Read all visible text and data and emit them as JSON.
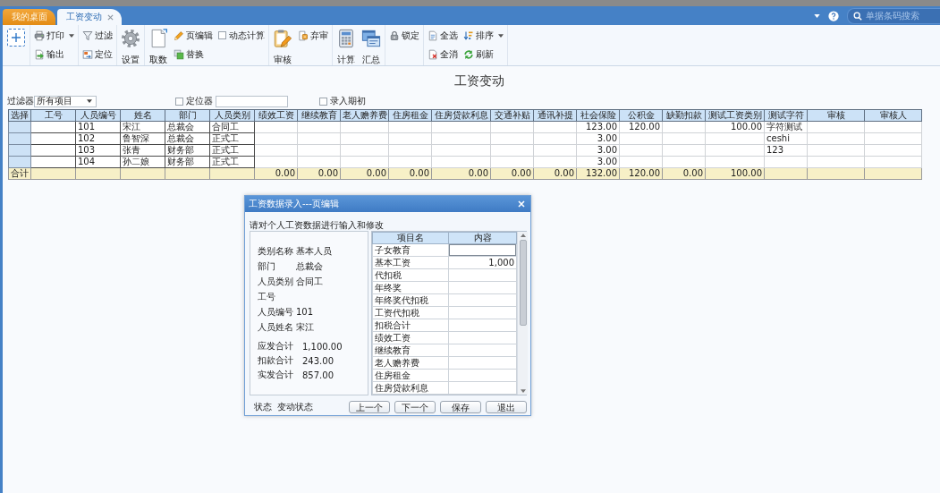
{
  "tabs": [
    {
      "label": "我的桌面",
      "selected": false,
      "closable": false
    },
    {
      "label": "工资变动",
      "selected": true,
      "closable": true
    }
  ],
  "search": {
    "placeholder": "单据条码搜索"
  },
  "toolbar": [
    {
      "items": [
        {
          "kind": "small",
          "label": "打印",
          "dropdown": true
        },
        {
          "kind": "small",
          "label": "输出",
          "dropdown": false
        }
      ]
    },
    {
      "items": [
        {
          "kind": "small",
          "label": "过滤",
          "dropdown": false
        },
        {
          "kind": "small",
          "label": "定位",
          "dropdown": false
        }
      ]
    },
    {
      "items": [
        {
          "kind": "large",
          "label": "设置"
        }
      ]
    },
    {
      "items": [
        {
          "kind": "large",
          "label": "取数"
        },
        {
          "kind": "small",
          "label": "页编辑",
          "dropdown": false
        },
        {
          "kind": "small",
          "label": "替换",
          "dropdown": false
        },
        {
          "kind": "check",
          "label": "动态计算",
          "checked": false
        }
      ]
    },
    {
      "items": [
        {
          "kind": "large",
          "label": "审核"
        },
        {
          "kind": "small",
          "label": "弃审",
          "dropdown": false
        }
      ]
    },
    {
      "items": [
        {
          "kind": "large",
          "label": "计算"
        },
        {
          "kind": "large",
          "label": "汇总"
        }
      ]
    },
    {
      "items": [
        {
          "kind": "small",
          "label": "锁定",
          "dropdown": false
        }
      ]
    },
    {
      "items": [
        {
          "kind": "small",
          "label": "全选",
          "dropdown": false
        },
        {
          "kind": "small",
          "label": "全消",
          "dropdown": false
        },
        {
          "kind": "small",
          "label": "排序",
          "dropdown": true
        },
        {
          "kind": "small",
          "label": "刷新",
          "dropdown": false
        }
      ]
    }
  ],
  "page_title": "工资变动",
  "filter": {
    "label": "过滤器",
    "value": "所有项目"
  },
  "locator": {
    "label": "定位器",
    "checked": false
  },
  "opening_entry": {
    "label": "录入期初",
    "checked": false
  },
  "table": {
    "columns": [
      {
        "label": "选择",
        "kind": "select"
      },
      {
        "label": "工号",
        "kind": "key"
      },
      {
        "label": "人员编号",
        "kind": "key"
      },
      {
        "label": "姓名",
        "kind": "key"
      },
      {
        "label": "部门",
        "kind": "key"
      },
      {
        "label": "人员类别",
        "kind": "key"
      },
      {
        "label": "绩效工资",
        "kind": "number"
      },
      {
        "label": "继续教育",
        "kind": "number"
      },
      {
        "label": "老人赡养费",
        "kind": "number"
      },
      {
        "label": "住房租金",
        "kind": "number"
      },
      {
        "label": "住房贷款利息",
        "kind": "number"
      },
      {
        "label": "交通补贴",
        "kind": "number"
      },
      {
        "label": "通讯补提",
        "kind": "number"
      },
      {
        "label": "社会保险",
        "kind": "number"
      },
      {
        "label": "公积金",
        "kind": "number"
      },
      {
        "label": "缺勤扣款",
        "kind": "number"
      },
      {
        "label": "测试工资类别",
        "kind": "number"
      },
      {
        "label": "测试字符",
        "kind": "text"
      },
      {
        "label": "审核",
        "kind": "text"
      },
      {
        "label": "审核人",
        "kind": "text"
      }
    ],
    "rows": [
      {
        "selected": false,
        "cells": [
          "",
          "",
          "101",
          "宋江",
          "总裁会",
          "合同工",
          "",
          "",
          "",
          "",
          "",
          "",
          "",
          "123.00",
          "120.00",
          "",
          "100.00",
          "字符测试",
          "",
          ""
        ]
      },
      {
        "selected": false,
        "cells": [
          "",
          "",
          "102",
          "鲁智深",
          "总裁会",
          "正式工",
          "",
          "",
          "",
          "",
          "",
          "",
          "",
          "3.00",
          "",
          "",
          "",
          "ceshi",
          "",
          ""
        ]
      },
      {
        "selected": false,
        "cells": [
          "",
          "",
          "103",
          "张青",
          "财务部",
          "正式工",
          "",
          "",
          "",
          "",
          "",
          "",
          "",
          "3.00",
          "",
          "",
          "",
          "123",
          "",
          ""
        ]
      },
      {
        "selected": false,
        "cells": [
          "",
          "",
          "104",
          "孙二娘",
          "财务部",
          "正式工",
          "",
          "",
          "",
          "",
          "",
          "",
          "",
          "3.00",
          "",
          "",
          "",
          "",
          "",
          ""
        ]
      }
    ],
    "totals": {
      "cells": [
        "合计",
        "",
        "",
        "",
        "",
        "",
        "0.00",
        "0.00",
        "0.00",
        "0.00",
        "0.00",
        "0.00",
        "0.00",
        "132.00",
        "120.00",
        "0.00",
        "100.00",
        "",
        "",
        ""
      ]
    }
  },
  "dialog": {
    "title": "工资数据录入---页编辑",
    "instruction": "请对个人工资数据进行输入和修改",
    "fields": [
      {
        "label": "类别名称",
        "value": "基本人员"
      },
      {
        "label": "部门",
        "value": "总裁会"
      },
      {
        "label": "人员类别",
        "value": "合同工"
      },
      {
        "label": "工号"
      },
      {
        "label": "人员编号",
        "value": "101"
      },
      {
        "label": "人员姓名",
        "value": "宋江"
      }
    ],
    "totals": [
      {
        "label": "应发合计",
        "value": "1,100.00"
      },
      {
        "label": "扣款合计",
        "value": "243.00"
      },
      {
        "label": "实发合计",
        "value": "857.00"
      }
    ],
    "grid": {
      "columns": [
        "项目名",
        "内容"
      ],
      "rows": [
        {
          "name": "子女教育",
          "editing": true
        },
        {
          "name": "基本工资",
          "value": "1,000",
          "editing": false
        },
        {
          "name": "代扣税",
          "editing": false
        },
        {
          "name": "年终奖",
          "editing": false
        },
        {
          "name": "年终奖代扣税",
          "editing": false
        },
        {
          "name": "工资代扣税",
          "editing": false
        },
        {
          "name": "扣税合计",
          "editing": false
        },
        {
          "name": "绩效工资",
          "editing": false
        },
        {
          "name": "继续教育",
          "editing": false
        },
        {
          "name": "老人赡养费",
          "editing": false
        },
        {
          "name": "住房租金",
          "editing": false
        },
        {
          "name": "住房贷款利息",
          "editing": false
        }
      ]
    },
    "status": {
      "label": "状态",
      "value": "变动状态"
    },
    "buttons": [
      "上一个",
      "下一个",
      "保存",
      "退出"
    ]
  }
}
